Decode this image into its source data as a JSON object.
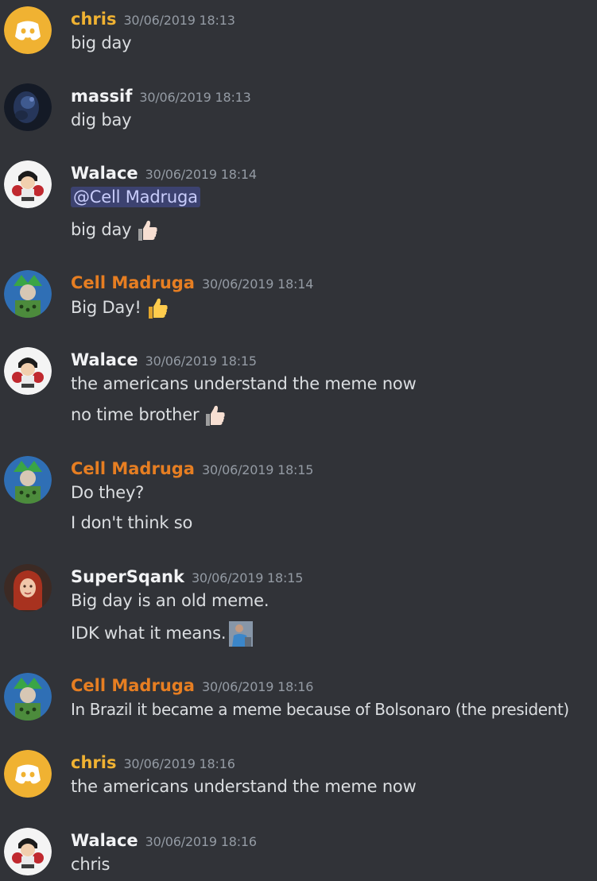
{
  "colors": {
    "background": "#313338",
    "text": "#dbdee1",
    "timestamp": "#949ba4",
    "author_default": "#f2f3f5",
    "author_yellow": "#f0b232",
    "author_orange": "#e67e22",
    "mention_bg": "#3c4270",
    "mention_text": "#c9cdfb"
  },
  "messages": [
    {
      "author": "chris",
      "timestamp": "30/06/2019 18:13",
      "avatar": "discord-logo-icon",
      "lines": [
        "big day"
      ]
    },
    {
      "author": "massif",
      "timestamp": "30/06/2019 18:13",
      "avatar": "dark-portrait-avatar",
      "lines": [
        "dig bay"
      ]
    },
    {
      "author": "Walace",
      "timestamp": "30/06/2019 18:14",
      "avatar": "boxer-avatar",
      "mention": "@Cell Madruga",
      "lines": [
        "big day"
      ],
      "emoji": "thumbs-up-light-icon"
    },
    {
      "author": "Cell Madruga",
      "timestamp": "30/06/2019 18:14",
      "avatar": "cell-character-avatar",
      "lines": [
        "Big Day!"
      ],
      "emoji": "thumbs-up-yellow-icon"
    },
    {
      "author": "Walace",
      "timestamp": "30/06/2019 18:15",
      "avatar": "boxer-avatar",
      "lines": [
        "the americans understand the meme now",
        "no time brother"
      ],
      "emoji": "thumbs-up-light-icon"
    },
    {
      "author": "Cell Madruga",
      "timestamp": "30/06/2019 18:15",
      "avatar": "cell-character-avatar",
      "lines": [
        "Do they?",
        "I don't think so"
      ]
    },
    {
      "author": "SuperSqank",
      "timestamp": "30/06/2019 18:15",
      "avatar": "red-hair-avatar",
      "lines": [
        "Big day is an old meme.",
        "IDK what it means."
      ],
      "emoji": "custom-person-emoji-icon"
    },
    {
      "author": "Cell Madruga",
      "timestamp": "30/06/2019 18:16",
      "avatar": "cell-character-avatar",
      "lines": [
        "In Brazil it became a meme because of Bolsonaro (the president)"
      ]
    },
    {
      "author": "chris",
      "timestamp": "30/06/2019 18:16",
      "avatar": "discord-logo-icon",
      "lines": [
        "the americans understand the meme now"
      ]
    },
    {
      "author": "Walace",
      "timestamp": "30/06/2019 18:16",
      "avatar": "boxer-avatar",
      "lines": [
        "chris"
      ]
    }
  ]
}
